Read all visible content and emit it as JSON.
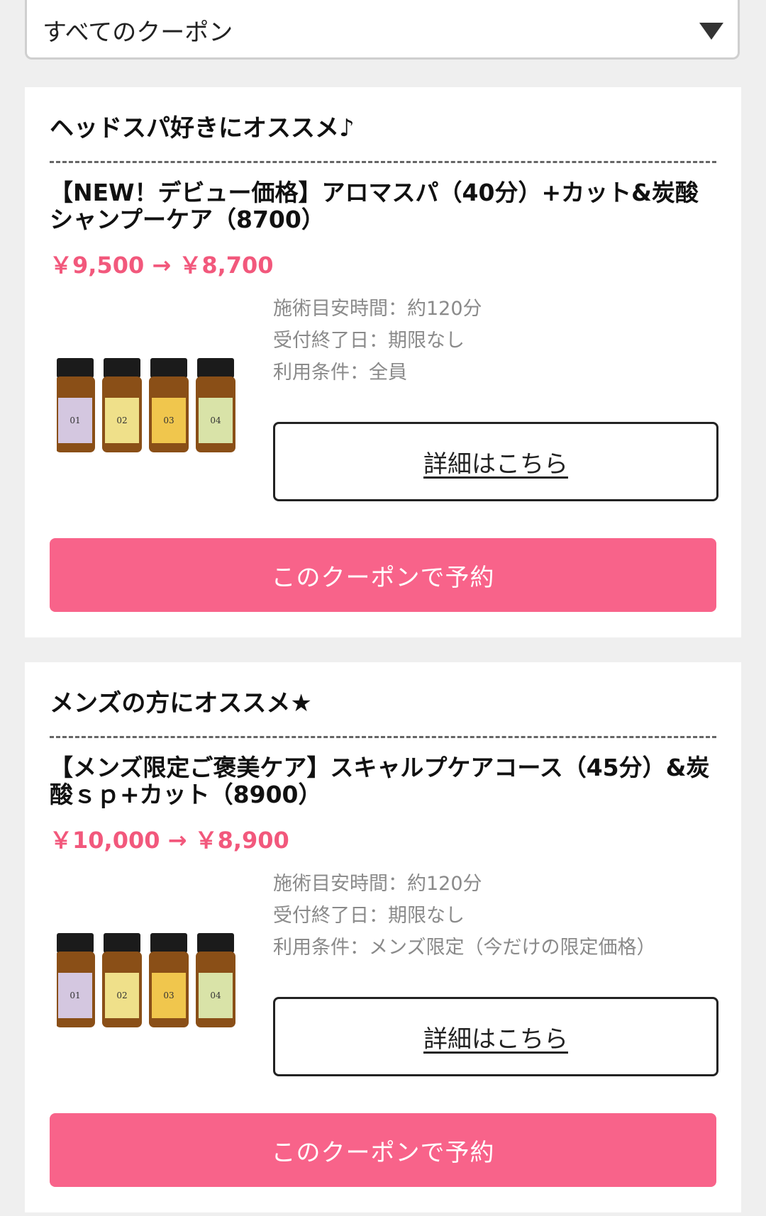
{
  "filter": {
    "selected": "すべてのクーポン",
    "caret_icon": "triangle-down-icon"
  },
  "coupons": [
    {
      "category": "ヘッドスパ好きにオススメ♪",
      "title": "【NEW！デビュー価格】アロマスパ（40分）+カット&炭酸シャンプーケア（8700）",
      "price": "￥9,500 → ￥8,700",
      "info": [
        "施術目安時間：約120分",
        "受付終了日：期限なし",
        "利用条件：全員"
      ],
      "detail_label": "詳細はこちら",
      "reserve_label": "このクーポンで予約"
    },
    {
      "category": "メンズの方にオススメ★",
      "title": "【メンズ限定ご褒美ケア】スキャルプケアコース（45分）&炭酸ｓｐ+カット（8900）",
      "price": "￥10,000 → ￥8,900",
      "info": [
        "施術目安時間：約120分",
        "受付終了日：期限なし",
        "利用条件：メンズ限定（今だけの限定価格）"
      ],
      "detail_label": "詳細はこちら",
      "reserve_label": "このクーポンで予約"
    }
  ],
  "bottle_numbers": [
    "01",
    "02",
    "03",
    "04"
  ],
  "colors": {
    "accent_pink": "#f8638a",
    "price_pink": "#f2587c",
    "background": "#efefef"
  }
}
